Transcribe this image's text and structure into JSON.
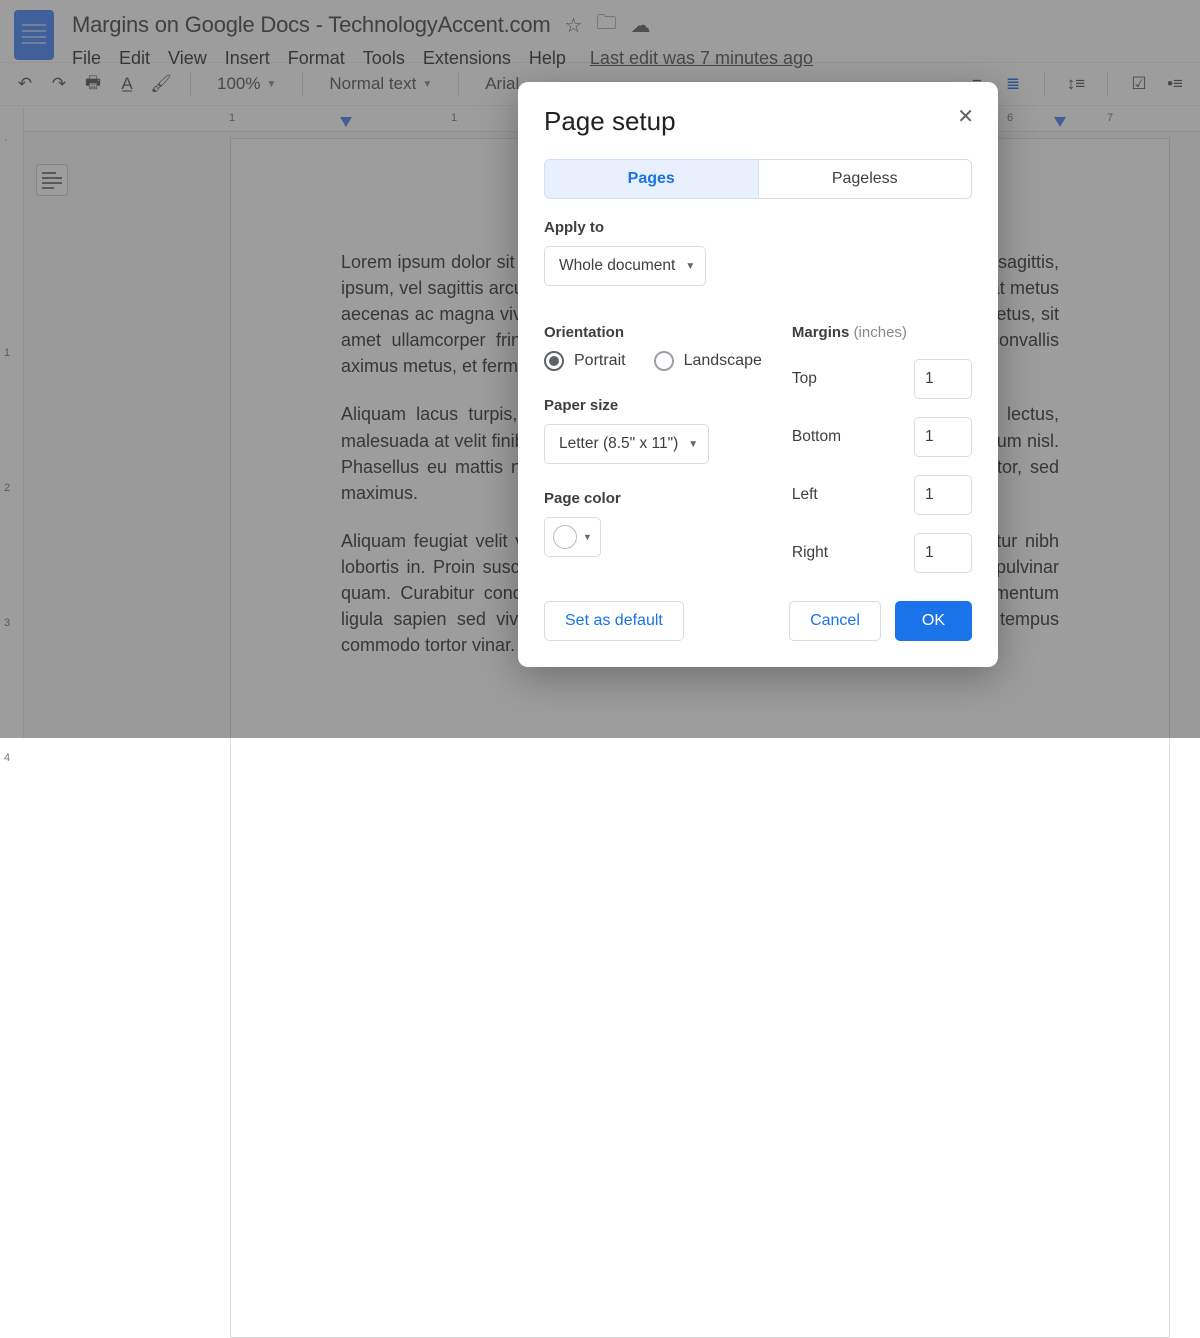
{
  "header": {
    "title": "Margins on Google Docs - TechnologyAccent.com",
    "edit_status": "Last edit was 7 minutes ago",
    "menus": [
      "File",
      "Edit",
      "View",
      "Insert",
      "Format",
      "Tools",
      "Extensions",
      "Help"
    ]
  },
  "toolbar": {
    "zoom": "100%",
    "style": "Normal text",
    "font": "Arial"
  },
  "hruler": {
    "ticks": [
      "1",
      "1",
      "6",
      "7"
    ],
    "positions": [
      232,
      454,
      1010,
      1110
    ],
    "marker1": 340,
    "marker2": 1054
  },
  "vruler": {
    "ticks": [
      "1",
      "2",
      "3",
      "4"
    ],
    "positions": [
      245,
      380,
      515,
      650
    ]
  },
  "document": {
    "p1": "Lorem ipsum dolor sit amet, consectetur adipiscing elit. Morbi rhoncus est id arcu sagittis, ipsum, vel sagittis arcu sagittis. Cras pellentesque, metus id fermentum mattis, erat metus aecenas ac magna viverra, sed fermentum velit. Vivamus condimentum viverra metus, sit amet ullamcorper fringilla. Vivamus hendrerit posuere elit. Sed ullamcorper convallis aximus metus, et fermentum.",
    "p2": "Aliquam lacus turpis, laoreet sit amet nisl non, tincidunt sagittis est. Sed mi lectus, malesuada at velit finibus nulla. Mauris at fermentum dui, sit amet uam, at fermentum nisl. Phasellus eu mattis nulla. Orci varius natoque penatibus et ulla eu turpis porttitor, sed maximus.",
    "p3": "Aliquam feugiat velit vitae ligula placerat luctus. Quisque semper faucibus efficitur nibh lobortis in. Proin suscipit ut libero et convallis. Nullam non cursus Integer eget pulvinar quam. Curabitur condimentum doctus lectus non m urna consequat. In condimentum ligula sapien sed viverra. npus in aliquam hendrerit, fringilla vitae nisl. Sed tempus commodo tortor vinar. In quis ullamcorper augue."
  },
  "modal": {
    "title": "Page setup",
    "tabs": {
      "pages": "Pages",
      "pageless": "Pageless"
    },
    "apply_label": "Apply to",
    "apply_value": "Whole document",
    "orientation_label": "Orientation",
    "portrait": "Portrait",
    "landscape": "Landscape",
    "paper_label": "Paper size",
    "paper_value": "Letter (8.5\" x 11\")",
    "color_label": "Page color",
    "margins_label": "Margins",
    "margins_unit": "(inches)",
    "margins": {
      "top": {
        "label": "Top",
        "value": "1"
      },
      "bottom": {
        "label": "Bottom",
        "value": "1"
      },
      "left": {
        "label": "Left",
        "value": "1"
      },
      "right": {
        "label": "Right",
        "value": "1"
      }
    },
    "buttons": {
      "default": "Set as default",
      "cancel": "Cancel",
      "ok": "OK"
    }
  }
}
